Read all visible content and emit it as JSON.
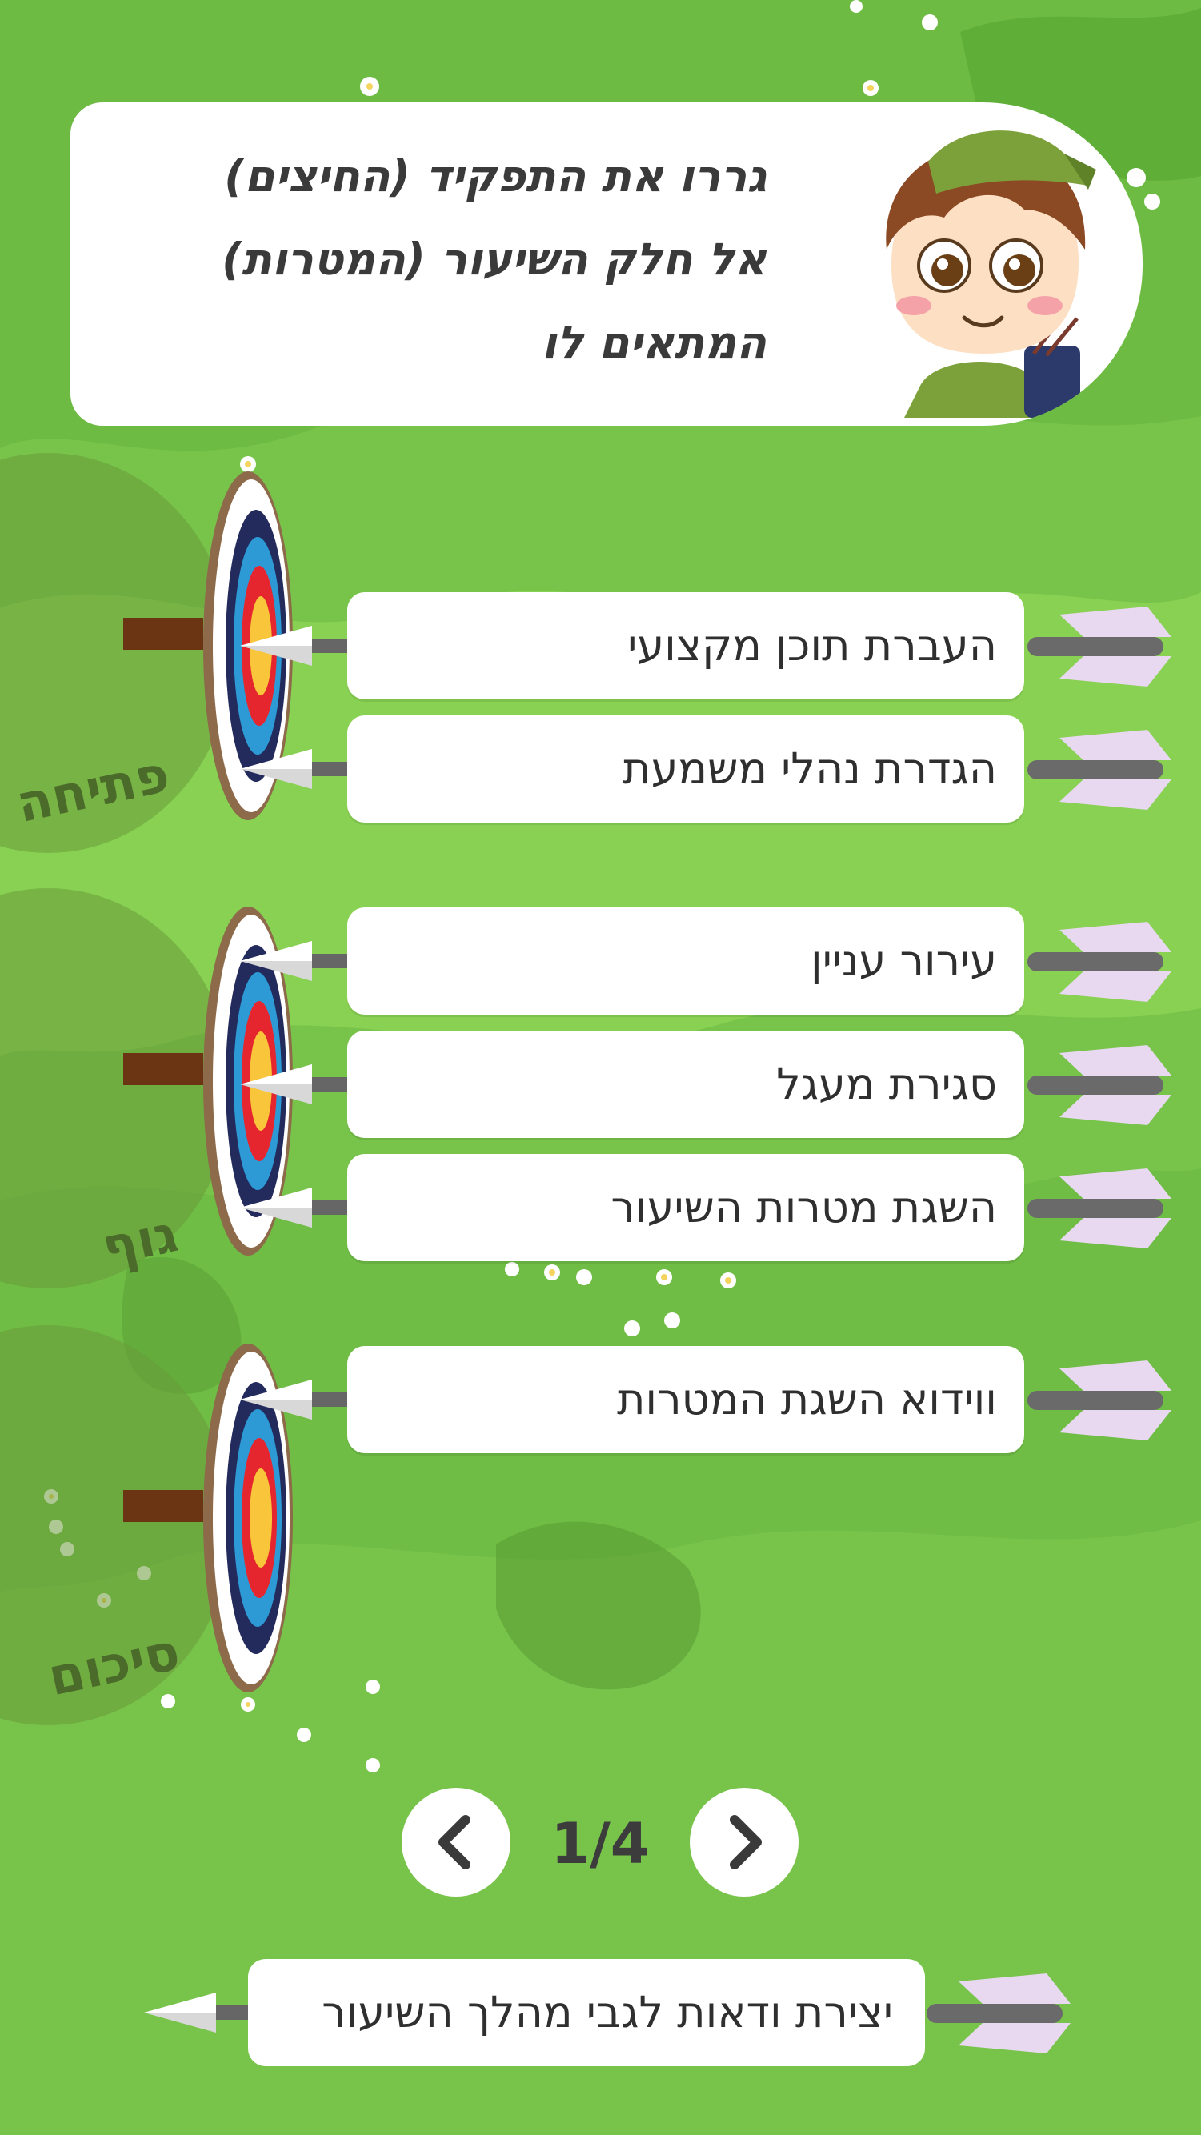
{
  "instruction": "גררו את התפקיד (החיצים) אל חלק השיעור (המטרות) המתאים לו",
  "sections": [
    {
      "label": "פתיחה"
    },
    {
      "label": "גוף"
    },
    {
      "label": "סיכום"
    }
  ],
  "answers": [
    {
      "text": "העברת תוכן מקצועי"
    },
    {
      "text": "הגדרת נהלי משמעת"
    },
    {
      "text": "עירור עניין"
    },
    {
      "text": "סגירת מעגל"
    },
    {
      "text": "השגת מטרות השיעור"
    },
    {
      "text": "ווידוא השגת המטרות"
    }
  ],
  "pagination": {
    "current": "1/4"
  },
  "pending_arrow": {
    "text": "יצירת ודאות לגבי מהלך השיעור"
  },
  "colors": {
    "background": "#76c24a",
    "card": "#ffffff",
    "text": "#2f2f2f",
    "section_label": "#4b6b2a",
    "target_red": "#e6262e",
    "target_blue": "#2d9ad6",
    "target_navy": "#232a5c",
    "target_gold": "#f9c53a"
  },
  "icons": {
    "prev": "chevron-left-icon",
    "next": "chevron-right-icon",
    "avatar": "archer-boy-avatar"
  }
}
